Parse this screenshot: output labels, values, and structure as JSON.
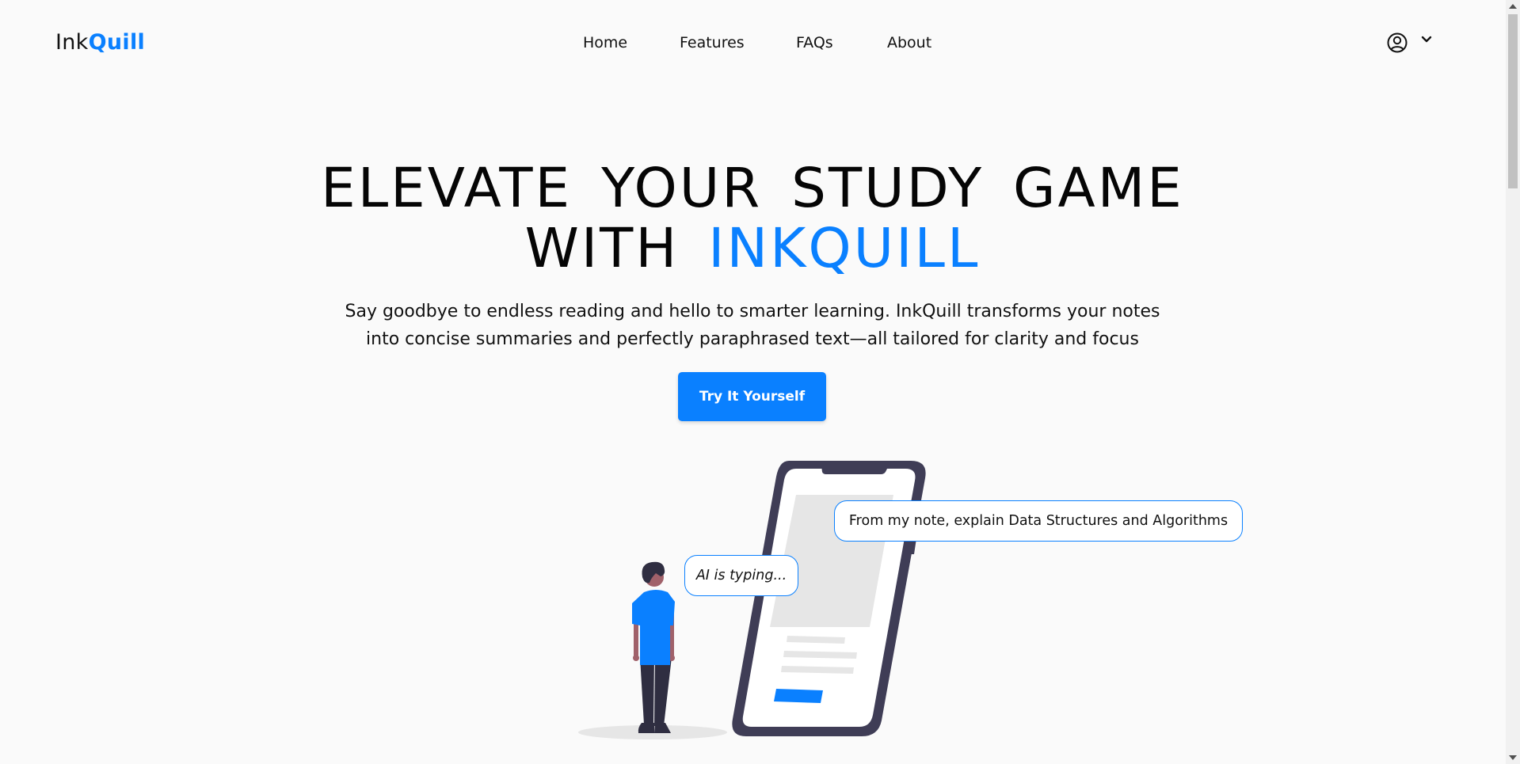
{
  "header": {
    "logo": {
      "part1": "Ink",
      "part2": "Quill"
    },
    "nav": [
      {
        "label": "Home"
      },
      {
        "label": "Features"
      },
      {
        "label": "FAQs"
      },
      {
        "label": "About"
      }
    ],
    "user_icon": "user-circle-icon",
    "dropdown_icon": "chevron-down-icon"
  },
  "hero": {
    "title_line1": "ELEVATE YOUR STUDY GAME",
    "title_line2_prefix": "WITH",
    "title_line2_accent": "INKQUILL",
    "subtitle_line1": "Say goodbye to endless reading and hello to smarter learning. InkQuill transforms your notes",
    "subtitle_line2": "into concise summaries and perfectly paraphrased text—all tailored for clarity and focus",
    "cta_label": "Try It Yourself"
  },
  "illustration": {
    "typing_bubble": "AI is typing...",
    "prompt_bubble": "From my note, explain Data Structures and Algorithms"
  },
  "colors": {
    "accent": "#0a80ff",
    "background": "#fafafa",
    "phone_frame": "#3f3d56",
    "skin": "#a0616a"
  }
}
